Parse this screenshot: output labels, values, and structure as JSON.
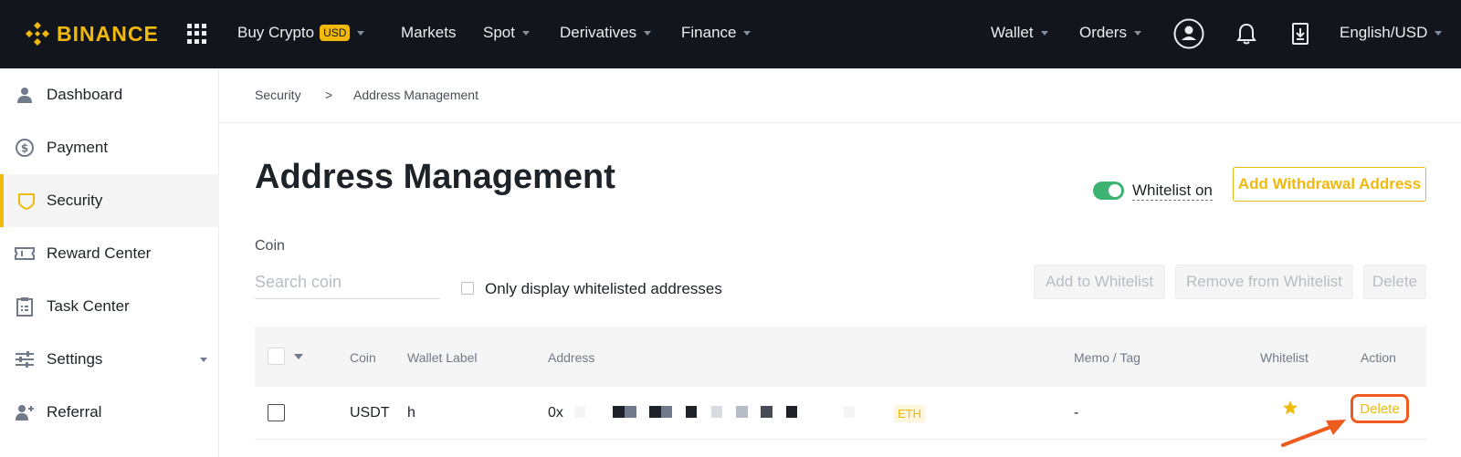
{
  "brand": {
    "name": "BINANCE",
    "accent": "#f0b90b",
    "nav_bg": "#12161c",
    "annotation_color": "#ef5a1e",
    "toggle_color": "#3cb371"
  },
  "topnav": {
    "items": [
      {
        "label": "Buy Crypto",
        "badge": "USD"
      },
      {
        "label": "Markets"
      },
      {
        "label": "Spot"
      },
      {
        "label": "Derivatives"
      },
      {
        "label": "Finance"
      }
    ],
    "right": {
      "wallet": "Wallet",
      "orders": "Orders",
      "language": "English/USD"
    },
    "icons": [
      "grid-icon",
      "user-icon",
      "bell-icon",
      "download-icon"
    ]
  },
  "sidebar": {
    "items": [
      {
        "label": "Dashboard",
        "icon": "user-icon"
      },
      {
        "label": "Payment",
        "icon": "dollar-icon"
      },
      {
        "label": "Security",
        "icon": "shield-icon",
        "active": true
      },
      {
        "label": "Reward Center",
        "icon": "ticket-icon"
      },
      {
        "label": "Task Center",
        "icon": "clipboard-icon"
      },
      {
        "label": "Settings",
        "icon": "sliders-icon",
        "expandable": true
      },
      {
        "label": "Referral",
        "icon": "user-plus-icon"
      }
    ]
  },
  "breadcrumb": {
    "parent": "Security",
    "separator": ">",
    "current": "Address Management"
  },
  "page": {
    "title": "Address Management",
    "whitelist_toggle_label": "Whitelist on",
    "whitelist_on": true,
    "add_address_button": "Add Withdrawal Address"
  },
  "filters": {
    "coin_label": "Coin",
    "search_placeholder": "Search coin",
    "only_whitelisted_label": "Only display whitelisted addresses",
    "add_to_whitelist": "Add to Whitelist",
    "remove_from_whitelist": "Remove from Whitelist",
    "delete": "Delete"
  },
  "table": {
    "columns": [
      "Coin",
      "Wallet Label",
      "Address",
      "Memo / Tag",
      "Whitelist",
      "Action"
    ],
    "rows": [
      {
        "coin": "USDT",
        "wallet_label": "h",
        "address_prefix": "0x",
        "network": "ETH",
        "memo": "-",
        "whitelisted": true,
        "action": "Delete"
      }
    ]
  }
}
